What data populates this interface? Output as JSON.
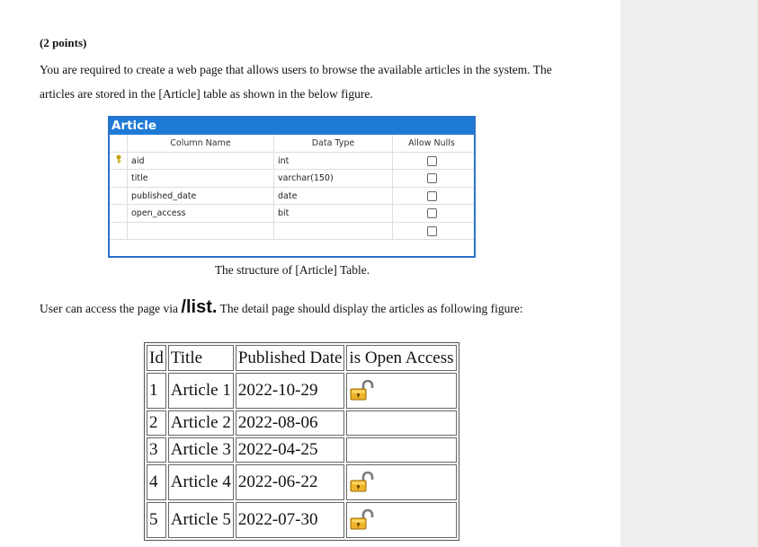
{
  "doc": {
    "points": "(2 points)",
    "intro_line1": "You are required to create a web page that allows users to browse the available articles in the system. The",
    "intro_line2": "articles are stored in the [Article] table as shown in the below figure.",
    "caption": "The structure of [Article] Table.",
    "access_prefix": "User can access the page via ",
    "access_route": "/list.",
    "access_suffix": " The detail page should display the articles as following figure:"
  },
  "schema": {
    "title": "Article",
    "headers": {
      "name": "Column Name",
      "type": "Data Type",
      "nulls": "Allow Nulls"
    },
    "rows": [
      {
        "name": "aid",
        "type": "int",
        "primary_key": true,
        "allow_nulls": false
      },
      {
        "name": "title",
        "type": "varchar(150)",
        "primary_key": false,
        "allow_nulls": false
      },
      {
        "name": "published_date",
        "type": "date",
        "primary_key": false,
        "allow_nulls": false
      },
      {
        "name": "open_access",
        "type": "bit",
        "primary_key": false,
        "allow_nulls": false
      },
      {
        "name": "",
        "type": "",
        "primary_key": false,
        "allow_nulls": false
      }
    ]
  },
  "list": {
    "headers": {
      "id": "Id",
      "title": "Title",
      "date": "Published Date",
      "open": "is Open Access"
    },
    "rows": [
      {
        "id": "1",
        "title": "Article 1",
        "date": "2022-10-29",
        "open_access": true
      },
      {
        "id": "2",
        "title": "Article 2",
        "date": "2022-08-06",
        "open_access": false
      },
      {
        "id": "3",
        "title": "Article 3",
        "date": "2022-04-25",
        "open_access": false
      },
      {
        "id": "4",
        "title": "Article 4",
        "date": "2022-06-22",
        "open_access": true
      },
      {
        "id": "5",
        "title": "Article 5",
        "date": "2022-07-30",
        "open_access": true
      }
    ],
    "open_icon": "unlocked-padlock-icon"
  }
}
